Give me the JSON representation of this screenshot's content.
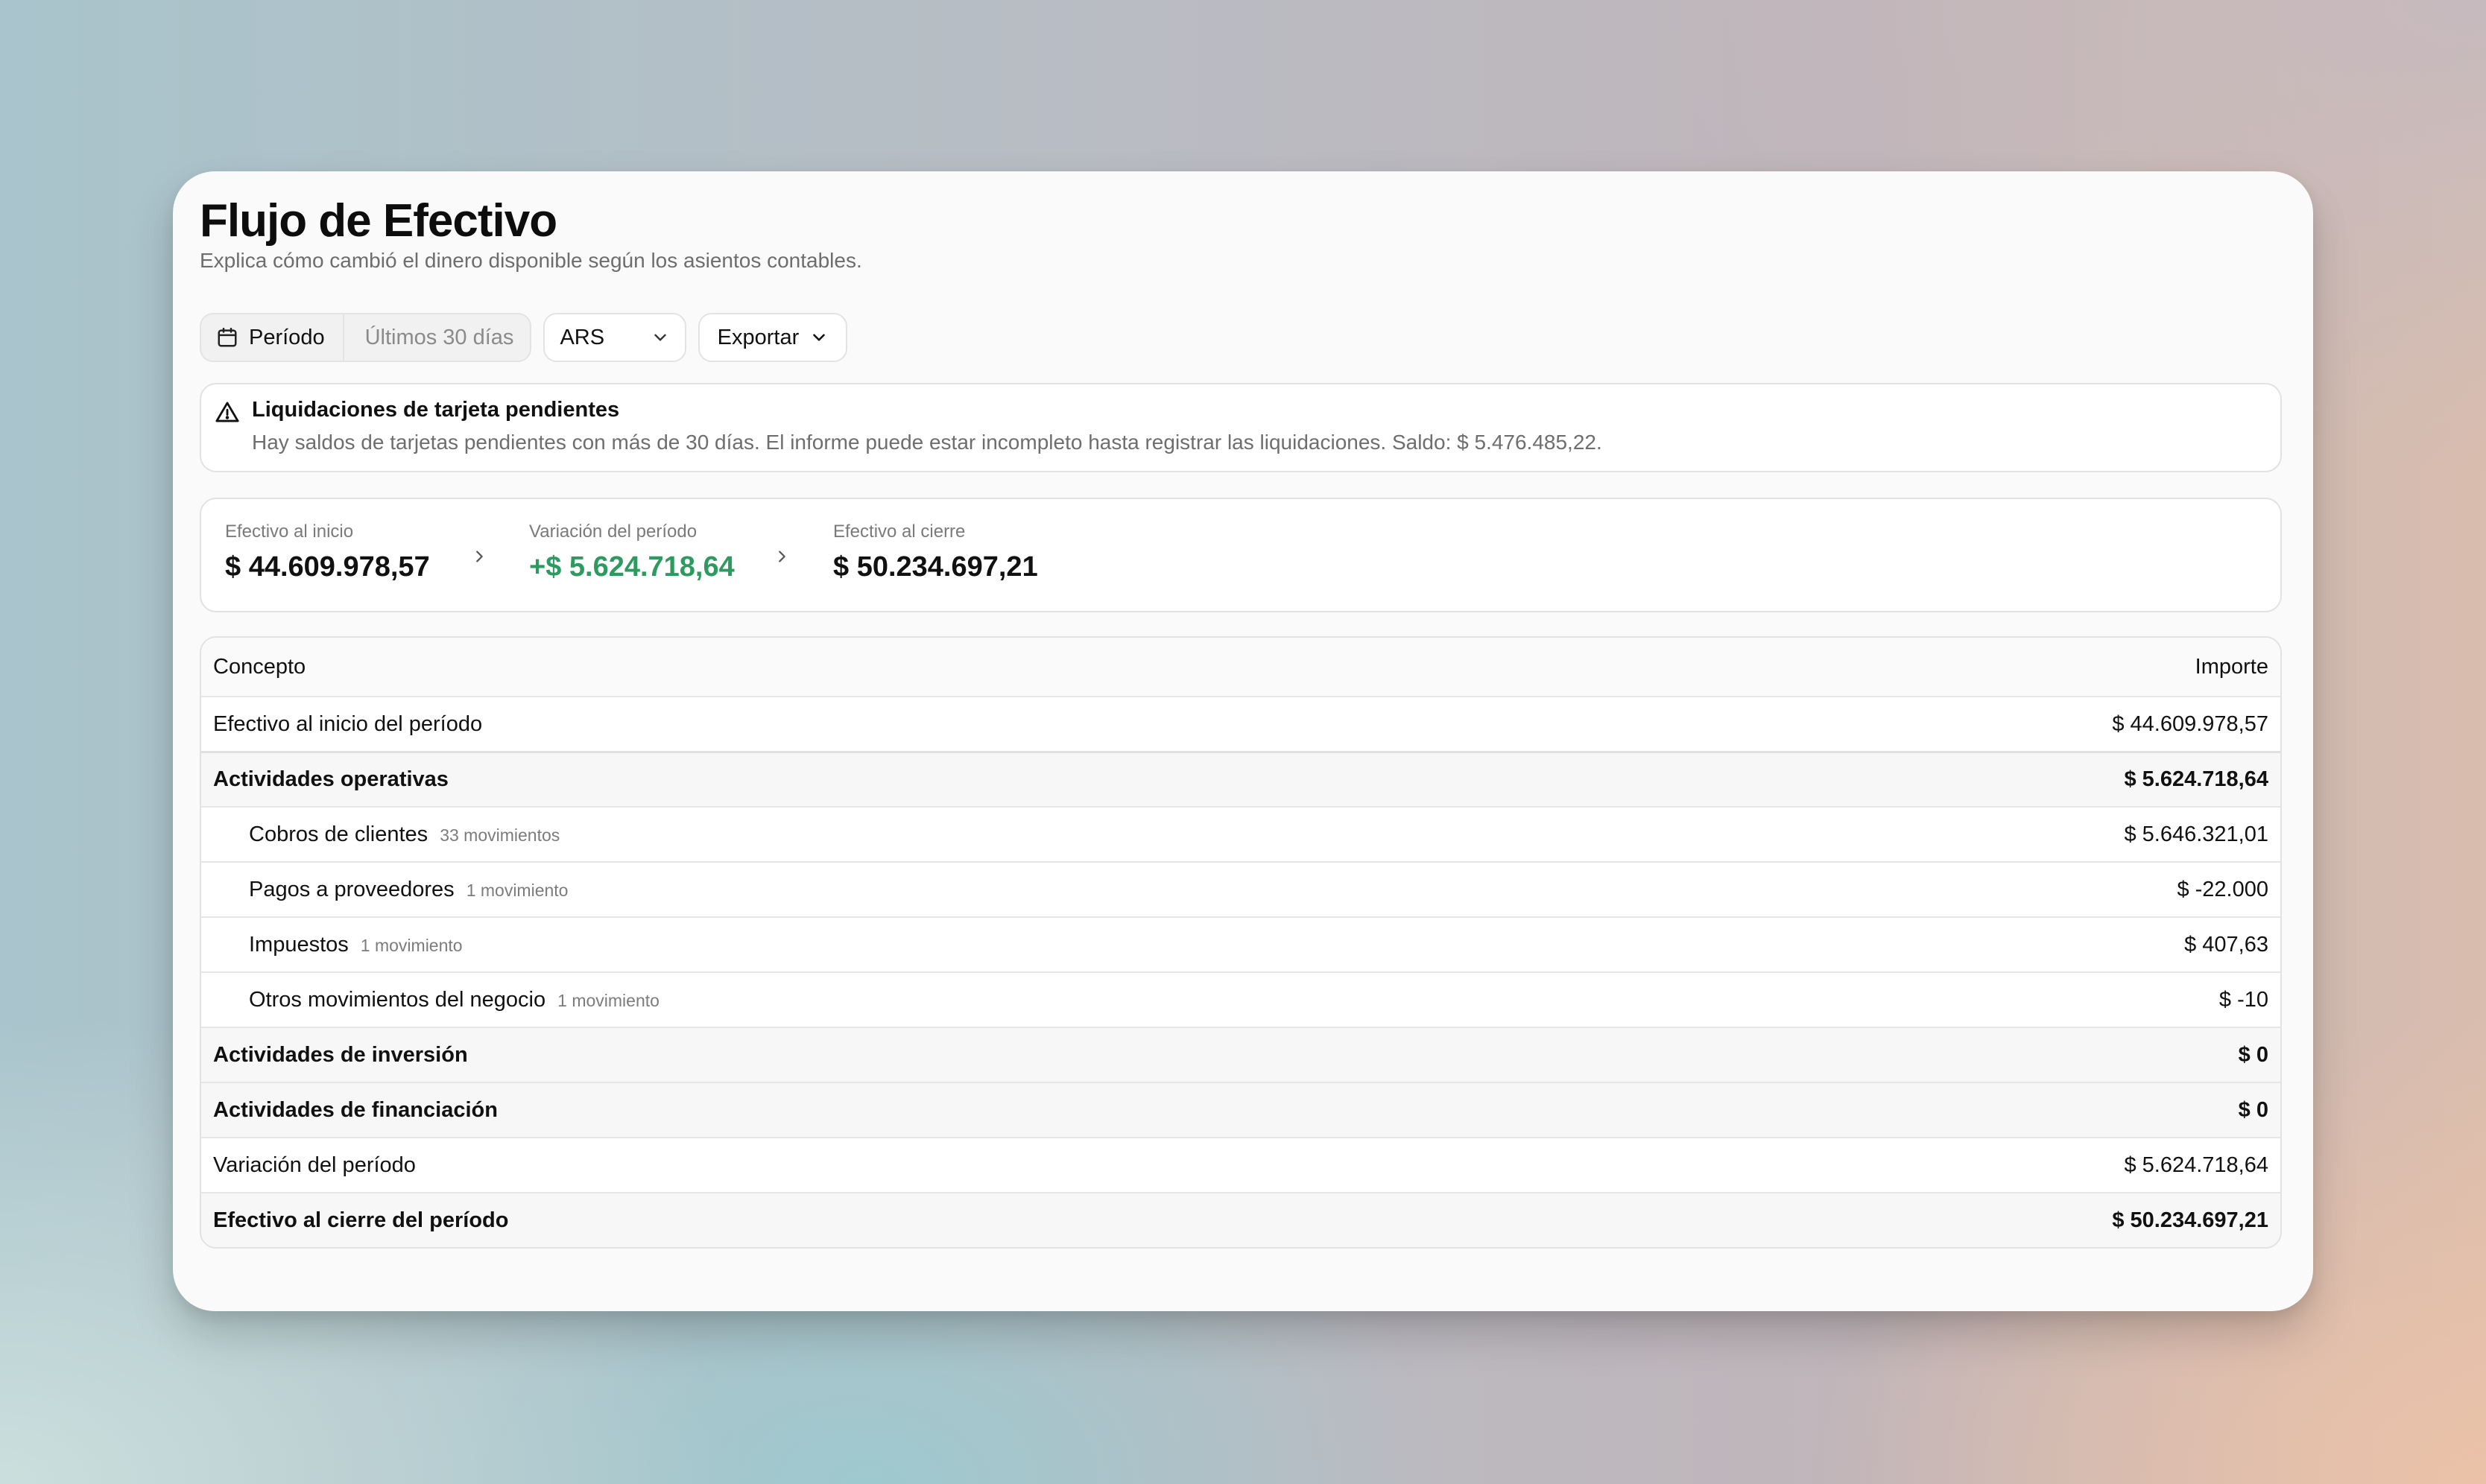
{
  "page": {
    "title": "Flujo de Efectivo",
    "subtitle": "Explica cómo cambió el dinero disponible según los asientos contables."
  },
  "toolbar": {
    "period_label": "Período",
    "period_value": "Últimos 30 días",
    "currency": "ARS",
    "export_label": "Exportar"
  },
  "alert": {
    "title": "Liquidaciones de tarjeta pendientes",
    "body": "Hay saldos de tarjetas pendientes con más de 30 días. El informe puede estar incompleto hasta registrar las liquidaciones. Saldo: $ 5.476.485,22."
  },
  "summary": {
    "start_label": "Efectivo al inicio",
    "start_value": "$ 44.609.978,57",
    "change_label": "Variación del período",
    "change_value": "+$ 5.624.718,64",
    "end_label": "Efectivo al cierre",
    "end_value": "$ 50.234.697,21"
  },
  "table": {
    "col_concept": "Concepto",
    "col_amount": "Importe",
    "rows": [
      {
        "concept": "Efectivo al inicio del período",
        "amount": "$ 44.609.978,57"
      },
      {
        "concept": "Actividades operativas",
        "amount": "$ 5.624.718,64"
      },
      {
        "concept": "Cobros de clientes",
        "count": "33 movimientos",
        "amount": "$ 5.646.321,01"
      },
      {
        "concept": "Pagos a proveedores",
        "count": "1 movimiento",
        "amount": "$ -22.000"
      },
      {
        "concept": "Impuestos",
        "count": "1 movimiento",
        "amount": "$ 407,63"
      },
      {
        "concept": "Otros movimientos del negocio",
        "count": "1 movimiento",
        "amount": "$ -10"
      },
      {
        "concept": "Actividades de inversión",
        "amount": "$ 0"
      },
      {
        "concept": "Actividades de financiación",
        "amount": "$ 0"
      },
      {
        "concept": "Variación del período",
        "amount": "$ 5.624.718,64"
      },
      {
        "concept": "Efectivo al cierre del período",
        "amount": "$ 50.234.697,21"
      }
    ]
  },
  "colors": {
    "positive": "#2f9a5f",
    "card_background": "#fafafa"
  },
  "icons": [
    "calendar-icon",
    "chevron-down-icon",
    "warning-icon",
    "chevron-right-icon"
  ]
}
